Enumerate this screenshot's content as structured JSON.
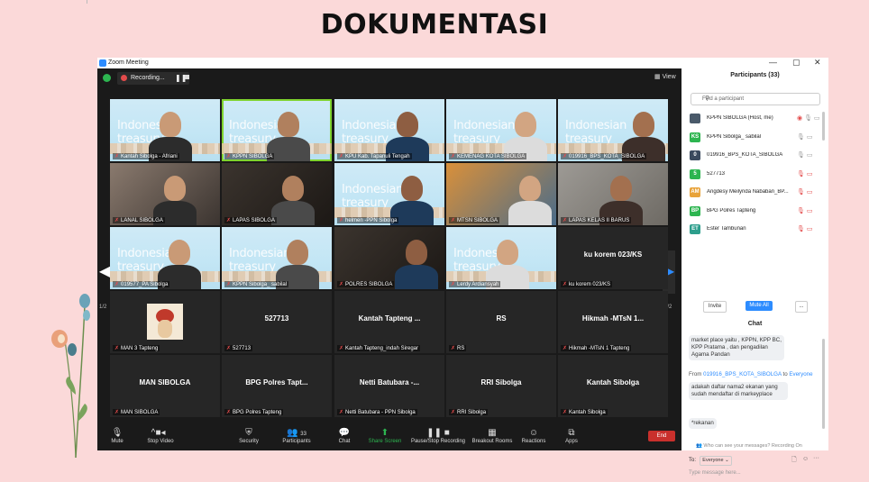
{
  "slide": {
    "title": "DOKUMENTASI"
  },
  "window": {
    "title": "Zoom Meeting",
    "controls": [
      "—",
      "▢",
      "✕"
    ]
  },
  "meeting": {
    "recording_label": "Recording...",
    "view_label": "View",
    "page_left": "1/2",
    "page_right": "1/2",
    "tiles": [
      {
        "name": "Kantah Sibolga - Afriani",
        "bg": "treasury",
        "muted": true
      },
      {
        "name": "KPPN SIBOLGA",
        "bg": "treasury",
        "muted": true,
        "active": true
      },
      {
        "name": "KPU Kab. Tapanuli Tengah",
        "bg": "treasury",
        "muted": true
      },
      {
        "name": "KEMENAG KOTA SIBOLGA",
        "bg": "treasury",
        "muted": true
      },
      {
        "name": "019916_BPS_KOTA_SIBOLGA",
        "bg": "treasury",
        "muted": true
      },
      {
        "name": "LANAL SIBOLGA",
        "bg": "room",
        "muted": true
      },
      {
        "name": "LAPAS SIBOLGA",
        "bg": "dark",
        "muted": true
      },
      {
        "name": "helmen -PPN Sibolga",
        "bg": "treasury",
        "muted": true
      },
      {
        "name": "MTSN SIBOLGA",
        "bg": "office",
        "muted": true
      },
      {
        "name": "LAPAS KELAS II BARUS",
        "bg": "wall",
        "muted": true
      },
      {
        "name": "019577_PA Sibolga",
        "bg": "treasury",
        "muted": true
      },
      {
        "name": "KPPN Sibolga_ sabilal",
        "bg": "treasury",
        "muted": true
      },
      {
        "name": "POLRES SIBOLGA",
        "bg": "dark",
        "muted": true
      },
      {
        "name": "Lerdy Ardiansyah",
        "bg": "treasury",
        "muted": true
      },
      {
        "name": "ku korem 023/KS",
        "big": "ku korem 023/KS",
        "muted": true
      },
      {
        "name": "MAN 3 Tapteng",
        "avatar": true,
        "muted": true
      },
      {
        "name": "527713",
        "big": "527713",
        "muted": true
      },
      {
        "name": "Kantah Tapteng_indah Siregar",
        "big": "Kantah Tapteng ...",
        "muted": true
      },
      {
        "name": "RS",
        "big": "RS",
        "muted": true
      },
      {
        "name": "Hikmah -MTsN 1 Tapteng",
        "big": "Hikmah -MTsN 1...",
        "muted": true
      },
      {
        "name": "MAN SIBOLGA",
        "big": "MAN SIBOLGA",
        "muted": true
      },
      {
        "name": "BPG Polres Tapteng",
        "big": "BPG Polres Tapt...",
        "muted": true
      },
      {
        "name": "Netti Batubara - PPN Sibolga",
        "big": "Netti Batubara -...",
        "muted": true
      },
      {
        "name": "RRI Sibolga",
        "big": "RRI Sibolga",
        "muted": true
      },
      {
        "name": "Kantah Sibolga",
        "big": "Kantah Sibolga",
        "muted": true
      }
    ],
    "toolbar": {
      "mute": "Mute",
      "stop_video": "Stop Video",
      "security": "Security",
      "participants": "Participants",
      "participants_count": "33",
      "chat": "Chat",
      "share_screen": "Share Screen",
      "pause_recording": "Pause/Stop Recording",
      "breakout": "Breakout Rooms",
      "reactions": "Reactions",
      "apps": "Apps",
      "end": "End"
    }
  },
  "participants": {
    "header": "Participants (33)",
    "search_placeholder": "Find a participant",
    "list": [
      {
        "initials": "",
        "name": "KPPN SIBOLGA (Host, me)",
        "color": "#4a5a6a",
        "icons": "◉ 🎙 ▭"
      },
      {
        "initials": "KS",
        "name": "KPPN Sibolga_ sabilal",
        "color": "#2db550",
        "icons": "🎙 ▭"
      },
      {
        "initials": "0",
        "name": "019916_BPS_KOTA_SIBOLGA",
        "color": "#3b4a5e",
        "icons": "🎙 ▭"
      },
      {
        "initials": "5",
        "name": "527713",
        "color": "#2db550",
        "icons": "🎙 ▭"
      },
      {
        "initials": "AM",
        "name": "Angdesy Meilynda Nababan_BP...",
        "color": "#e8a33a",
        "icons": "🎙 ▭"
      },
      {
        "initials": "BP",
        "name": "BPG Polres Tapteng",
        "color": "#2db550",
        "icons": "🎙 ▭"
      },
      {
        "initials": "ET",
        "name": "Ester Tambunan",
        "color": "#2d9e8c",
        "icons": "🎙 ▭"
      }
    ],
    "invite": "Invite",
    "mute_all": "Mute All",
    "more": "..."
  },
  "chat": {
    "header": "Chat",
    "msg1": "market place yaitu , KPPN, KPP BC, KPP Pratama , dan pengadilan Agama Pandan",
    "from_prefix": "From",
    "from_sender": "019916_BPS_KOTA_SIBOLGA",
    "from_to": "to",
    "from_target": "Everyone",
    "msg2": "adakah daftar nama2 ekanan yang sudah mendaftar di markeyplace",
    "msg3": "*rekanan",
    "who_can_see": "Who can see your messages? Recording On",
    "to_label": "To:",
    "to_value": "Everyone",
    "compose_placeholder": "Type message here..."
  }
}
